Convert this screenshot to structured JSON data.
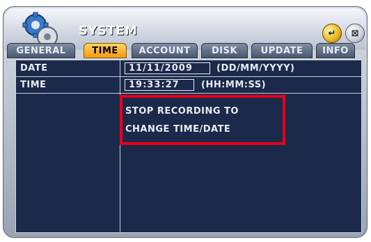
{
  "window": {
    "title": "SYSTEM"
  },
  "title_buttons": [
    {
      "icon": "enter-icon",
      "glyph": "↵"
    },
    {
      "icon": "close-icon",
      "glyph": "⊠"
    }
  ],
  "tabs": [
    {
      "label": "GENERAL",
      "active": false
    },
    {
      "label": "TIME",
      "active": true
    },
    {
      "label": "ACCOUNT",
      "active": false
    },
    {
      "label": "DISK",
      "active": false
    },
    {
      "label": "UPDATE",
      "active": false
    },
    {
      "label": "INFO",
      "active": false
    }
  ],
  "rows": {
    "date": {
      "label": "DATE",
      "value": "11/11/2009",
      "format": "(DD/MM/YYYY)"
    },
    "time": {
      "label": "TIME",
      "value": "19:33:27",
      "format": "(HH:MM:SS)"
    }
  },
  "message": {
    "line1": "STOP RECORDING TO",
    "line2": "CHANGE TIME/DATE"
  },
  "colors": {
    "panel": "#1b2a4a",
    "active_tab": "#f39a15",
    "highlight": "#e8001b"
  }
}
